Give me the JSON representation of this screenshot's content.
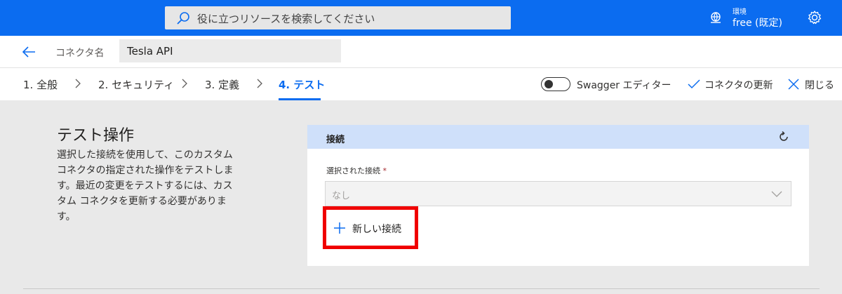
{
  "header": {
    "search_placeholder": "役に立つリソースを検索してください",
    "environment_label": "環境",
    "environment_value": "free (既定)"
  },
  "connector": {
    "name_label": "コネクタ名",
    "name_value": "Tesla API"
  },
  "steps": [
    {
      "label": "1. 全般",
      "active": false
    },
    {
      "label": "2. セキュリティ",
      "active": false
    },
    {
      "label": "3. 定義",
      "active": false
    },
    {
      "label": "4. テスト",
      "active": true
    }
  ],
  "toolbar": {
    "swagger_label": "Swagger エディター",
    "swagger_on": false,
    "update_label": "コネクタの更新",
    "close_label": "閉じる"
  },
  "section": {
    "title": "テスト操作",
    "description": "選択した接続を使用して、このカスタム コネクタの指定された操作をテストします。最近の変更をテストするには、カスタム コネクタを更新する必要があります。"
  },
  "connection": {
    "title": "接続",
    "field_label": "選択された接続",
    "required_mark": "*",
    "selected_value": "なし",
    "new_connection_label": "新しい接続"
  },
  "colors": {
    "accent": "#0b6cf0",
    "highlight": "#f00000",
    "card_header": "#cfe0fa"
  }
}
